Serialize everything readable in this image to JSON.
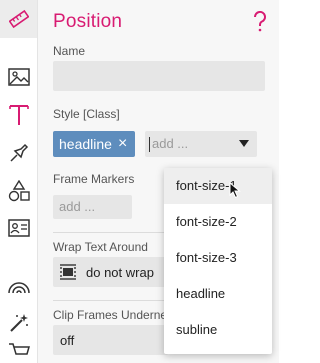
{
  "header": {
    "title": "Position",
    "help_icon": "question-mark-icon"
  },
  "name_field": {
    "label": "Name",
    "value": ""
  },
  "style_field": {
    "label": "Style [Class]",
    "tags": [
      "headline"
    ],
    "select_placeholder": "add ...",
    "options": [
      "font-size-1",
      "font-size-2",
      "font-size-3",
      "headline",
      "subline"
    ],
    "hovered_option": "font-size-1"
  },
  "frame_markers": {
    "label": "Frame Markers",
    "placeholder": "add ..."
  },
  "wrap_text": {
    "label": "Wrap Text Around",
    "value": "do not wrap"
  },
  "clip_frames": {
    "label": "Clip Frames Underne",
    "value": "off"
  },
  "rail": {
    "icons": [
      "ruler-icon",
      "image-icon",
      "text-icon",
      "pin-icon",
      "shapes-icon",
      "contact-card-icon",
      "rainbow-icon",
      "magic-wand-icon",
      "cart-icon"
    ]
  },
  "colors": {
    "accent": "#d81b72",
    "tag": "#5e8dbd",
    "panel_bg": "#f7f7f7",
    "field_bg": "#e6e6e6"
  }
}
